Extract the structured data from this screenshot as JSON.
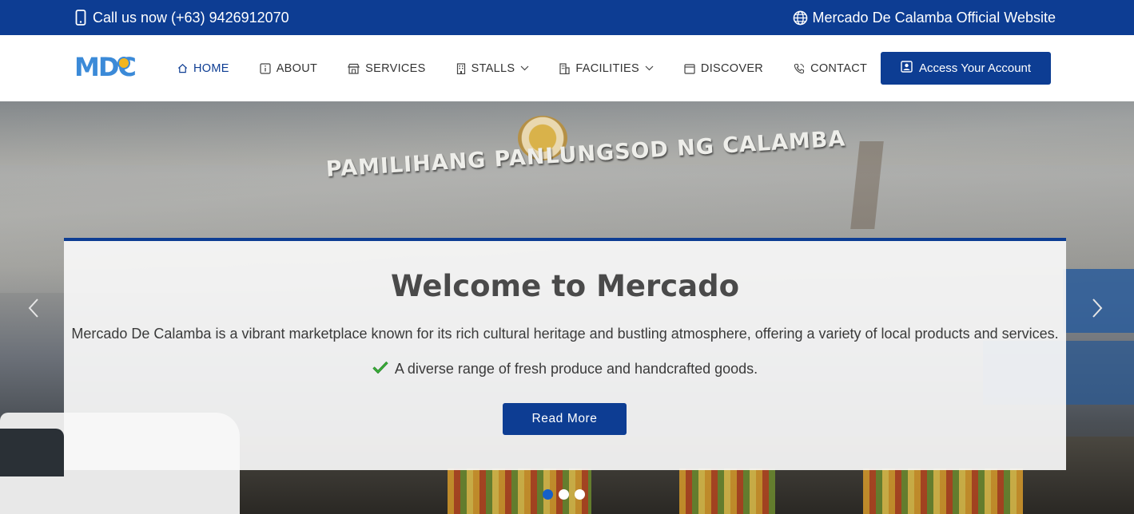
{
  "topbar": {
    "phone_icon": "mobile-phone-icon",
    "phone_text": "Call us now (+63) 9426912070",
    "globe_icon": "globe-icon",
    "site_text": "Mercado De Calamba Official Website"
  },
  "logo": {
    "text": "MDC"
  },
  "nav": {
    "items": [
      {
        "label": "HOME",
        "icon": "home-icon",
        "active": true
      },
      {
        "label": "ABOUT",
        "icon": "info-icon"
      },
      {
        "label": "SERVICES",
        "icon": "shop-icon"
      },
      {
        "label": "STALLS",
        "icon": "building-icon",
        "dropdown": true
      },
      {
        "label": "FACILITIES",
        "icon": "buildings-icon",
        "dropdown": true
      },
      {
        "label": "DISCOVER",
        "icon": "calendar-icon"
      },
      {
        "label": "CONTACT",
        "icon": "phone-icon"
      }
    ],
    "account_button": "Access Your Account",
    "account_icon": "user-badge-icon"
  },
  "hero": {
    "sign_text": "PAMILIHANG PANLUNGSOD NG CALAMBA",
    "title": "Welcome to Mercado",
    "description": "Mercado De Calamba is a vibrant marketplace known for its rich cultural heritage and bustling atmosphere, offering a variety of local products and services.",
    "check_item": "A diverse range of fresh produce and handcrafted goods.",
    "read_more": "Read More",
    "slide_count": 3,
    "active_slide": 1
  },
  "colors": {
    "brand": "#0d3d93",
    "logo_blue": "#3b8ad8",
    "check_green": "#2e9a2e",
    "active_dot": "#1660c8"
  }
}
